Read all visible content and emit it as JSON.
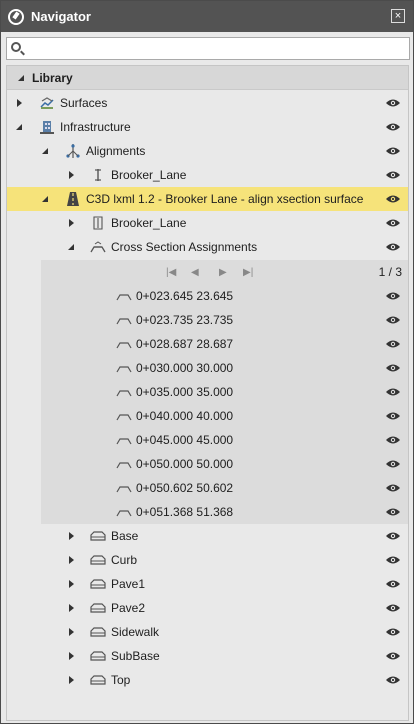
{
  "window": {
    "title": "Navigator",
    "close_glyph": "×"
  },
  "search": {
    "placeholder": "",
    "value": ""
  },
  "tree": {
    "header": "Library",
    "nodes": [
      {
        "label": "Surfaces",
        "icon": "surfaces-icon"
      },
      {
        "label": "Infrastructure",
        "icon": "infrastructure-icon"
      },
      {
        "label": "Alignments",
        "icon": "alignments-icon"
      },
      {
        "label": "Brooker_Lane",
        "icon": "alignment-icon"
      },
      {
        "label": "C3D lxml 1.2 - Brooker Lane - align xsection surface",
        "icon": "road-icon"
      },
      {
        "label": "Brooker_Lane",
        "icon": "alignment-icon"
      },
      {
        "label": "Cross Section Assignments",
        "icon": "cross-section-icon"
      }
    ],
    "pager": {
      "first": "|◀",
      "prev": "◀",
      "next": "▶",
      "last": "▶|",
      "count": "1 / 3"
    },
    "stations": [
      "0+023.645 23.645",
      "0+023.735 23.735",
      "0+028.687 28.687",
      "0+030.000 30.000",
      "0+035.000 35.000",
      "0+040.000 40.000",
      "0+045.000 45.000",
      "0+050.000 50.000",
      "0+050.602 50.602",
      "0+051.368 51.368"
    ],
    "layers": [
      "Base",
      "Curb",
      "Pave1",
      "Pave2",
      "Sidewalk",
      "SubBase",
      "Top"
    ]
  },
  "colors": {
    "selected": "#f6e37a",
    "titlebar": "#535353",
    "panel": "#e9e9e9"
  }
}
